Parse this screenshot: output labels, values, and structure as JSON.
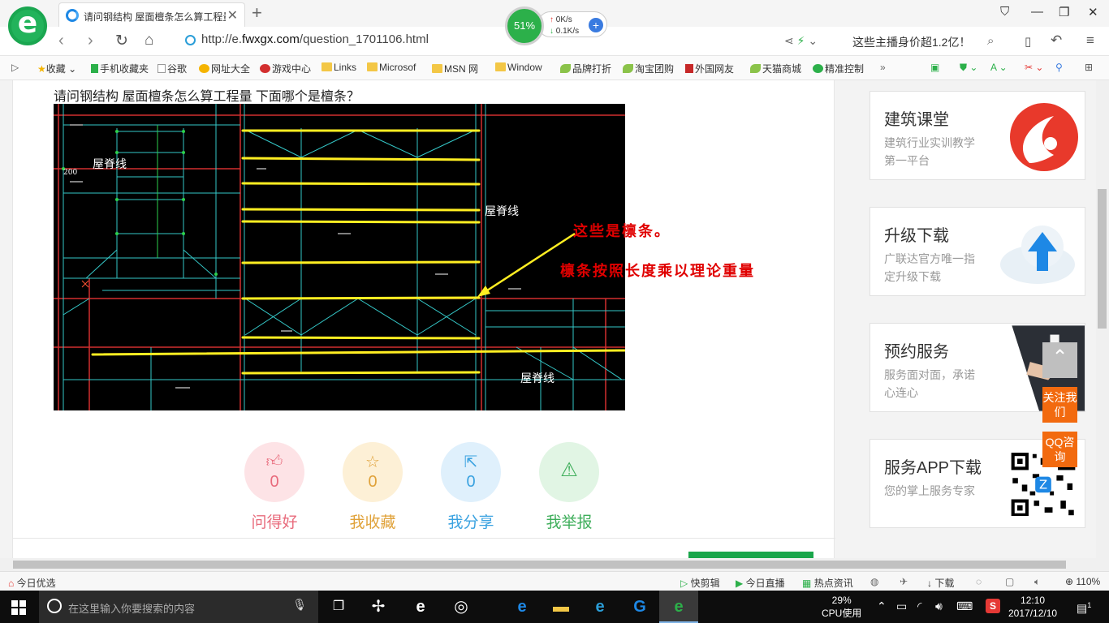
{
  "tab": {
    "title": "请问钢结构 屋面檀条怎么算工程量 下面哪个是檀条？"
  },
  "network": {
    "cpu_percent": "51%",
    "upload": "0K/s",
    "download": "0.1K/s"
  },
  "address": {
    "scheme": "http://e.",
    "host": "fwxgx.com",
    "path": "/question_1701106.html"
  },
  "news_search": "这些主播身价超1.2亿！",
  "bookmarks": [
    "收藏",
    "手机收藏夹",
    "谷歌",
    "网址大全",
    "游戏中心",
    "Links",
    "Microsof",
    "MSN 网",
    "Window",
    "品牌打折",
    "淘宝团购",
    "外国网友",
    "天猫商城",
    "精准控制"
  ],
  "question": {
    "title": "请问钢结构 屋面檀条怎么算工程量 下面哪个是檀条？"
  },
  "cad": {
    "label_1": "屋脊线",
    "label_2": "屋脊线",
    "label_3": "屋脊线",
    "dim": "200"
  },
  "annotation": {
    "line1": "这些是檩条。",
    "line2": "檩条按照长度乘以理论重量"
  },
  "actions": [
    {
      "label": "问得好",
      "count": "0",
      "icon": "thumbs-up-icon",
      "color": "#e86b7c",
      "bg": "#fde3e6"
    },
    {
      "label": "我收藏",
      "count": "0",
      "icon": "star-icon",
      "color": "#e0a23a",
      "bg": "#fdf0d6"
    },
    {
      "label": "我分享",
      "count": "0",
      "icon": "share-icon",
      "color": "#3aa2e0",
      "bg": "#dff0fc"
    },
    {
      "label": "我举报",
      "count": "",
      "icon": "warning-icon",
      "color": "#3fae5b",
      "bg": "#e1f5e4"
    }
  ],
  "sidebar": [
    {
      "title": "建筑课堂",
      "desc": "建筑行业实训教学第一平台"
    },
    {
      "title": "升级下载",
      "desc": "广联达官方唯一指定升级下载"
    },
    {
      "title": "预约服务",
      "desc": "服务面对面，承诺心连心"
    },
    {
      "title": "服务APP下载",
      "desc": "您的掌上服务专家"
    }
  ],
  "float": {
    "follow": "关注我们",
    "qq": "QQ咨询"
  },
  "statusbar": {
    "left": "今日优选",
    "kuaijian": "快剪辑",
    "live": "今日直播",
    "hot": "热点资讯",
    "download": "下载",
    "zoom": "110%"
  },
  "taskbar": {
    "search_placeholder": "在这里输入你要搜索的内容",
    "cpu": "29%",
    "cpu_label": "CPU使用",
    "time": "12:10",
    "date": "2017/12/10",
    "notif": "1"
  },
  "colors": {
    "accent_green": "#1aa64b",
    "annotation_red": "#e00000",
    "purlin_yellow": "#ffee22"
  }
}
